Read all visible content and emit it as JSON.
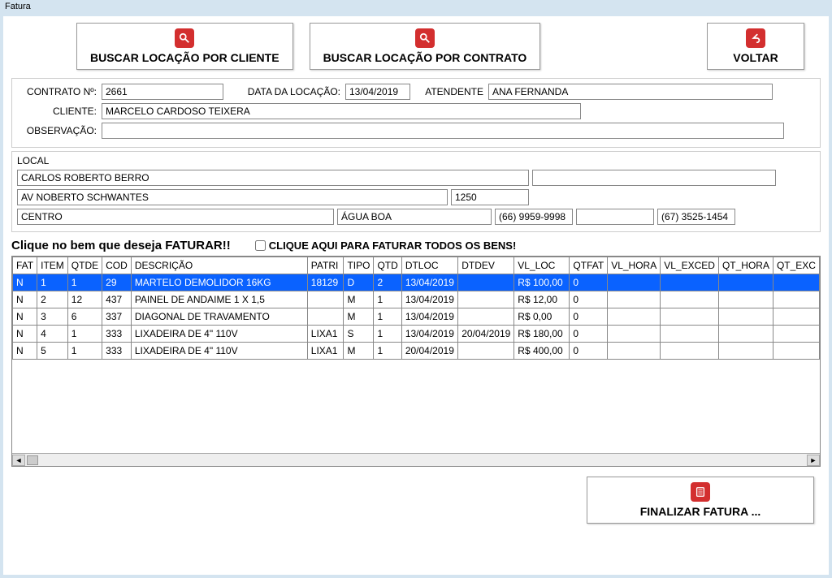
{
  "window": {
    "title": "Fatura"
  },
  "toolbar": {
    "btn_cliente": "BUSCAR LOCAÇÃO POR CLIENTE",
    "btn_contrato": "BUSCAR LOCAÇÃO POR CONTRATO",
    "btn_voltar": "VOLTAR"
  },
  "form": {
    "contrato_label": "CONTRATO Nº:",
    "contrato": "2661",
    "data_label": "DATA DA LOCAÇÃO:",
    "data": "13/04/2019",
    "atendente_label": "ATENDENTE",
    "atendente": "ANA FERNANDA",
    "cliente_label": "CLIENTE:",
    "cliente": "MARCELO CARDOSO TEIXERA",
    "obs_label": "OBSERVAÇÃO:",
    "obs": ""
  },
  "local": {
    "title": "LOCAL",
    "nome": "CARLOS ROBERTO BERRO",
    "extra": "",
    "rua": "AV NOBERTO SCHWANTES",
    "num": "1250",
    "bairro": "CENTRO",
    "cidade": "ÁGUA BOA",
    "fone1": "(66) 9959-9998",
    "fone2": "",
    "fone3": "(67) 3525-1454"
  },
  "instruction": {
    "text": "Clique no bem que deseja FATURAR!!",
    "checkbox_label": "CLIQUE AQUI PARA FATURAR TODOS OS BENS!"
  },
  "table": {
    "headers": {
      "fat": "FAT",
      "item": "ITEM",
      "qtde": "QTDE",
      "cod": "COD",
      "desc": "DESCRIÇÃO",
      "patri": "PATRI",
      "tipo": "TIPO",
      "qtd": "QTD",
      "dtloc": "DTLOC",
      "dtdev": "DTDEV",
      "vlloc": "VL_LOC",
      "qtfat": "QTFAT",
      "vlhora": "VL_HORA",
      "vlexced": "VL_EXCED",
      "qthora": "QT_HORA",
      "qtexc": "QT_EXC"
    },
    "rows": [
      {
        "fat": "N",
        "item": "1",
        "qtde": "1",
        "cod": "29",
        "desc": "MARTELO DEMOLIDOR 16KG",
        "patri": "18129",
        "tipo": "D",
        "qtd": "2",
        "dtloc": "13/04/2019",
        "dtdev": "",
        "vlloc": "R$ 100,00",
        "qtfat": "0",
        "vlhora": "",
        "vlexced": "",
        "qthora": "",
        "selected": true
      },
      {
        "fat": "N",
        "item": "2",
        "qtde": "12",
        "cod": "437",
        "desc": "PAINEL DE ANDAIME 1 X 1,5",
        "patri": "",
        "tipo": "M",
        "qtd": "1",
        "dtloc": "13/04/2019",
        "dtdev": "",
        "vlloc": "R$ 12,00",
        "qtfat": "0",
        "vlhora": "",
        "vlexced": "",
        "qthora": ""
      },
      {
        "fat": "N",
        "item": "3",
        "qtde": "6",
        "cod": "337",
        "desc": "DIAGONAL DE TRAVAMENTO",
        "patri": "",
        "tipo": "M",
        "qtd": "1",
        "dtloc": "13/04/2019",
        "dtdev": "",
        "vlloc": "R$ 0,00",
        "qtfat": "0",
        "vlhora": "",
        "vlexced": "",
        "qthora": ""
      },
      {
        "fat": "N",
        "item": "4",
        "qtde": "1",
        "cod": "333",
        "desc": "LIXADEIRA DE 4\" 110V",
        "patri": "LIXA1",
        "tipo": "S",
        "qtd": "1",
        "dtloc": "13/04/2019",
        "dtdev": "20/04/2019",
        "vlloc": "R$ 180,00",
        "qtfat": "0",
        "vlhora": "",
        "vlexced": "",
        "qthora": ""
      },
      {
        "fat": "N",
        "item": "5",
        "qtde": "1",
        "cod": "333",
        "desc": "LIXADEIRA DE 4\" 110V",
        "patri": "LIXA1",
        "tipo": "M",
        "qtd": "1",
        "dtloc": "20/04/2019",
        "dtdev": "",
        "vlloc": "R$ 400,00",
        "qtfat": "0",
        "vlhora": "",
        "vlexced": "",
        "qthora": ""
      }
    ]
  },
  "footer": {
    "finalizar": "FINALIZAR FATURA ..."
  }
}
